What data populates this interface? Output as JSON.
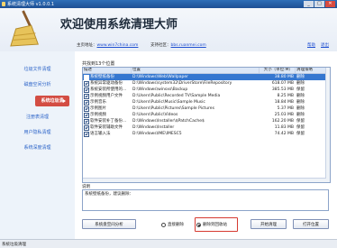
{
  "window": {
    "title": "系统清理大师  v1.0.0.1",
    "min": "_",
    "max": "□",
    "close": "✕"
  },
  "header": {
    "headline": "欢迎使用系统清理大师",
    "homepage_label": "主页地址：",
    "homepage_url": "www.win7china.com",
    "forum_label": "支持社区：",
    "forum_url": "bbs.ruanmei.com",
    "links": [
      "帮助",
      "退出"
    ]
  },
  "sidebar": {
    "items": [
      "垃圾文件清理",
      "磁盘空间分析",
      "系统垃圾清",
      "注册表清理",
      "用户隐私清理",
      "系统深度清理"
    ],
    "active_index": 2
  },
  "main": {
    "summary": "共找到13个位置",
    "columns": [
      "描述",
      "位置",
      "大小（单位:M）",
      "清理策略"
    ],
    "rows": [
      {
        "desc": "系统壁纸备份",
        "path": "D:\\Windows\\Web\\Wallpaper",
        "size": "38.80 MB",
        "policy": "删除",
        "selected": true
      },
      {
        "desc": "系统异常驱动备份",
        "path": "D:\\Windows\\system32\\DriverStore\\FileRepository",
        "size": "618.07 MB",
        "policy": "删除",
        "selected": false
      },
      {
        "desc": "系统安装所使用的...",
        "path": "D:\\Windows\\winsxs\\Backup",
        "size": "385.53 MB",
        "policy": "保留",
        "selected": false
      },
      {
        "desc": "示例视频用户文件",
        "path": "D:\\Users\\Public\\Recorded TV\\Sample Media",
        "size": "8.25 MB",
        "policy": "删除",
        "selected": false
      },
      {
        "desc": "示例音乐",
        "path": "D:\\Users\\Public\\Music\\Sample Music",
        "size": "18.84 MB",
        "policy": "删除",
        "selected": false
      },
      {
        "desc": "示例图片",
        "path": "D:\\Users\\Public\\Pictures\\Sample Pictures",
        "size": "5.37 MB",
        "policy": "删除",
        "selected": false
      },
      {
        "desc": "示例视频",
        "path": "D:\\Users\\Public\\Videos",
        "size": "25.03 MB",
        "policy": "删除",
        "selected": false
      },
      {
        "desc": "软件安装补丁备份...",
        "path": "D:\\Windows\\Installer\\$PatchCache$",
        "size": "162.20 MB",
        "policy": "保留",
        "selected": false
      },
      {
        "desc": "软件安装辅助文件",
        "path": "D:\\Windows\\Installer",
        "size": "11.83 MB",
        "policy": "保留",
        "selected": false
      },
      {
        "desc": "语言输入法",
        "path": "D:\\Windows\\IME\\IMESC5",
        "size": "74.42 MB",
        "policy": "保留",
        "selected": false
      }
    ]
  },
  "description": {
    "title": "说明",
    "text": "系统壁纸备份，建议删除："
  },
  "buttons": {
    "analyze": "系统盘空间分析",
    "radio_direct": "直接删除",
    "radio_recycle": "删除到回收站",
    "start": "开始清理",
    "open_location": "打开位置"
  },
  "radio_selected": "radio_recycle",
  "status": "系统垃圾清理"
}
